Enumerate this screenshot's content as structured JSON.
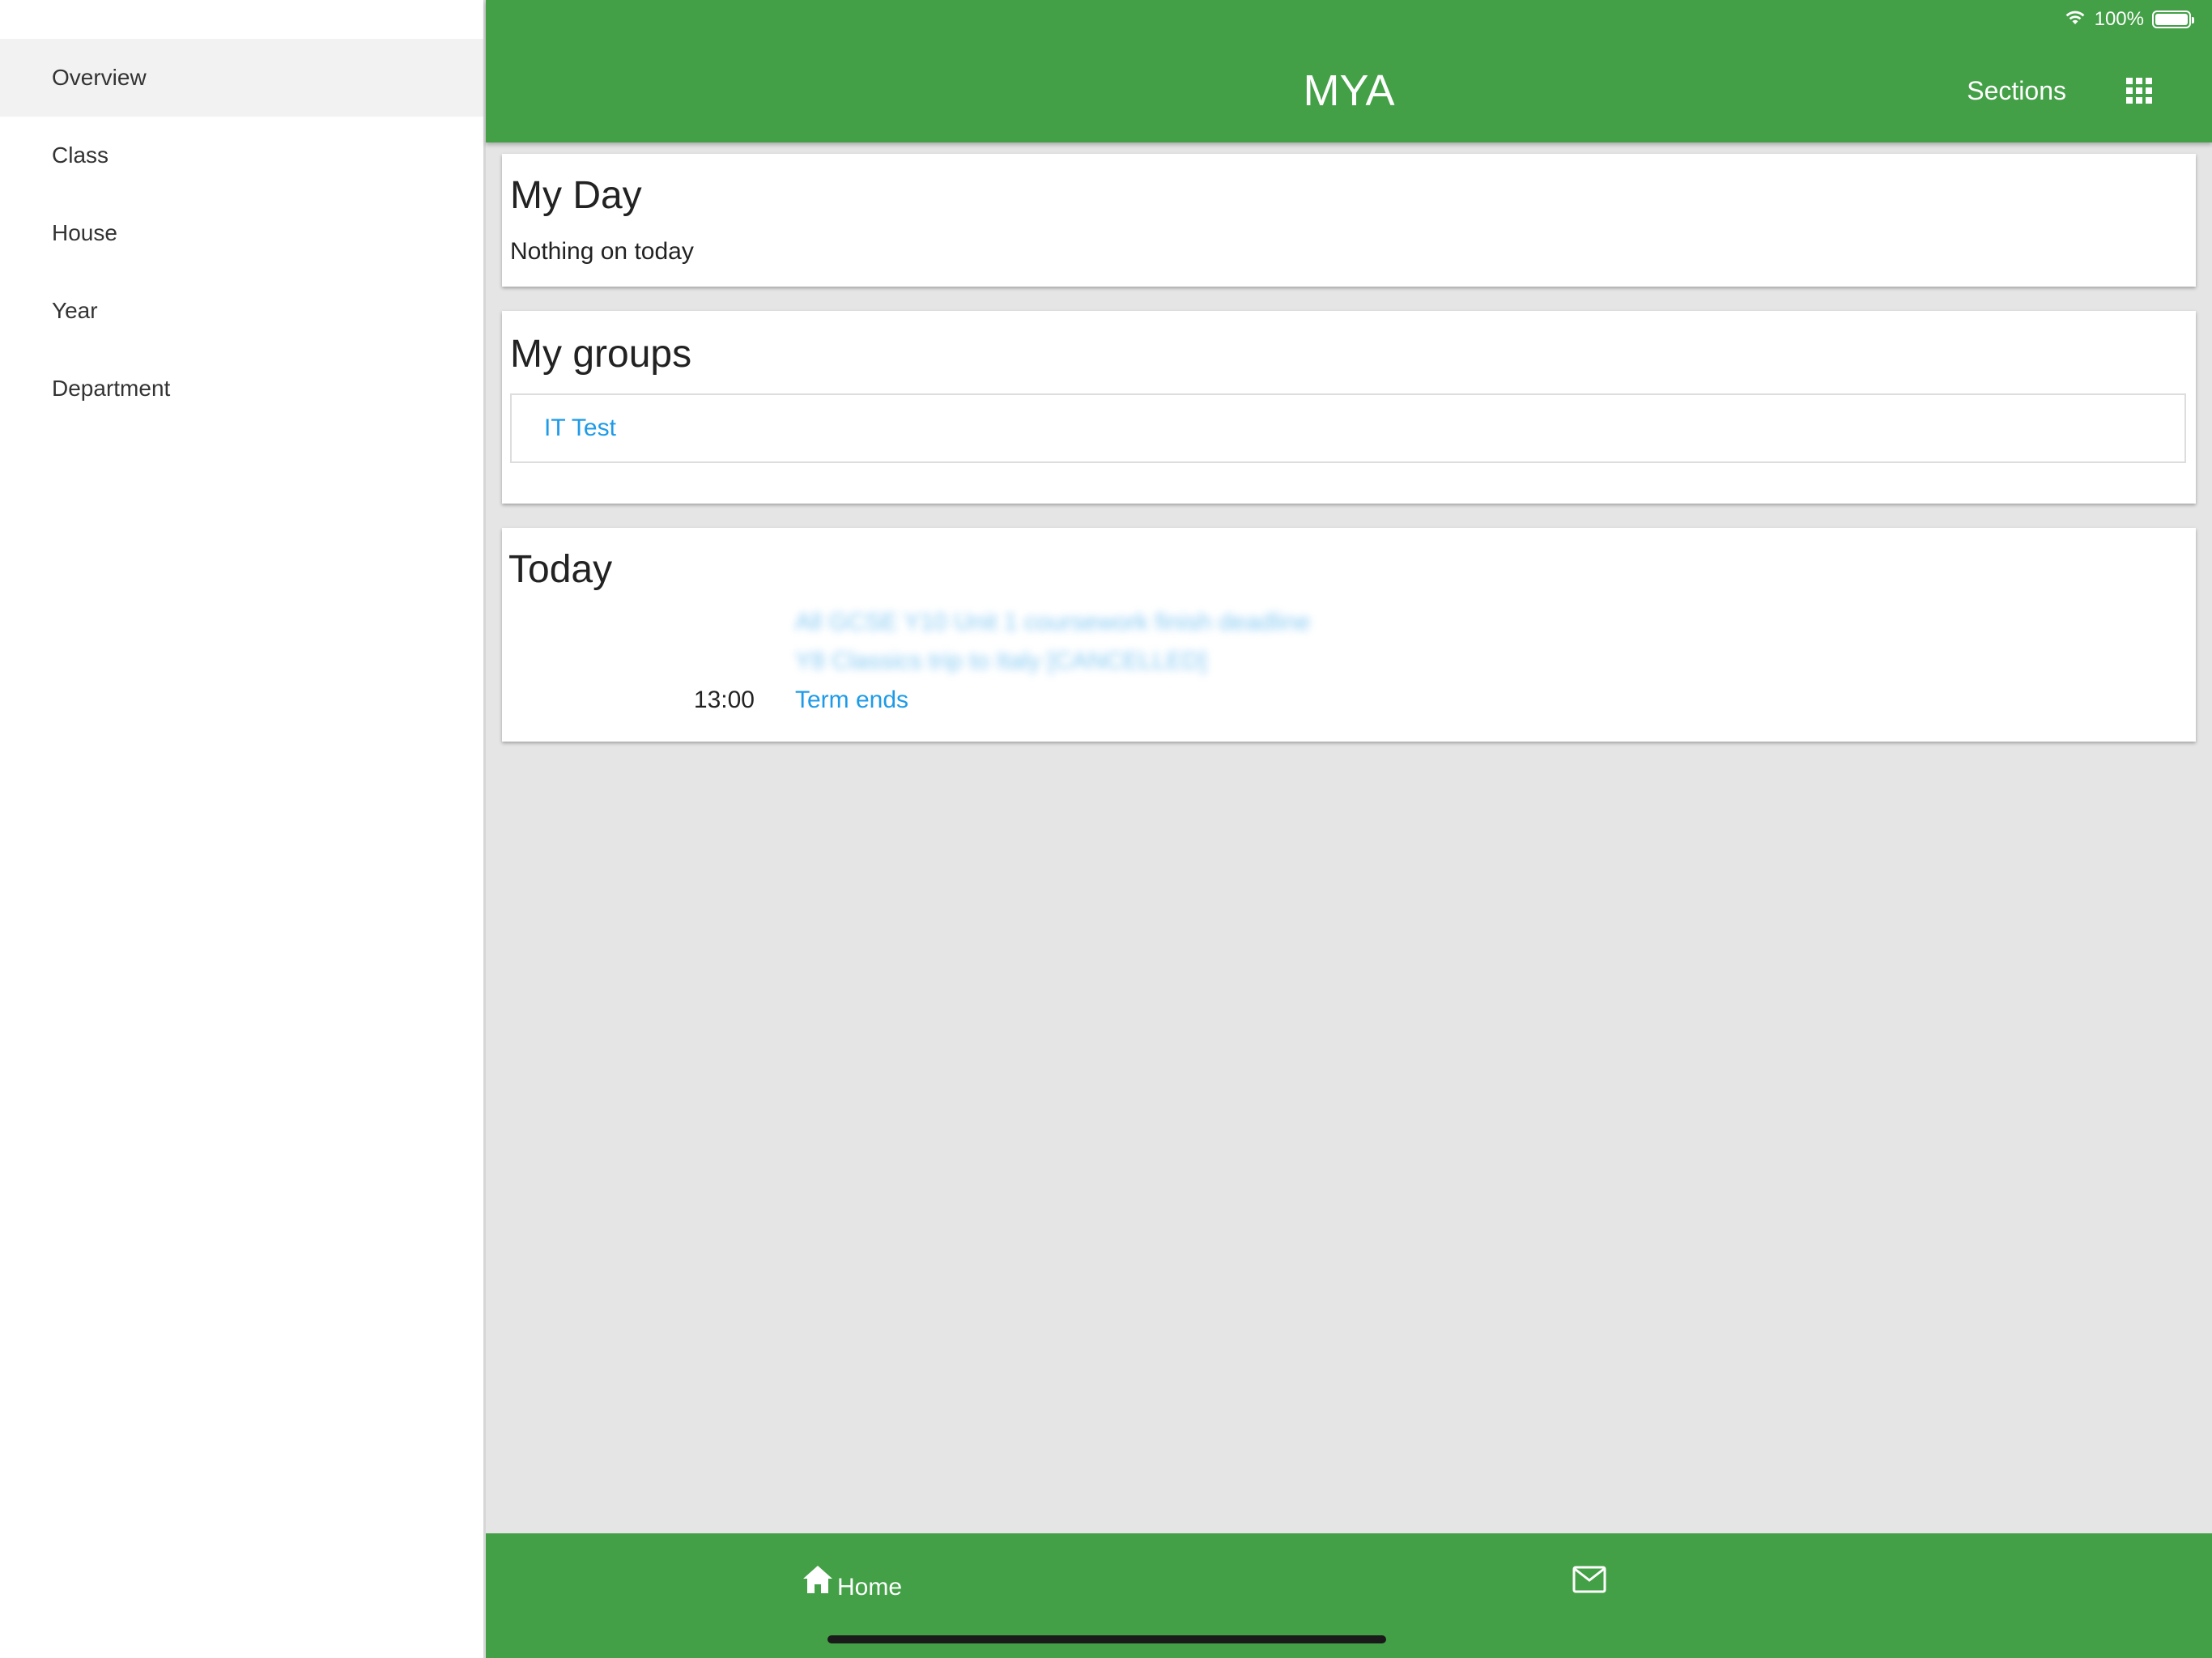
{
  "status_bar": {
    "battery_text": "100%",
    "icons": [
      "wifi-icon",
      "battery-icon"
    ]
  },
  "sidebar": {
    "items": [
      {
        "label": "Overview",
        "active": true
      },
      {
        "label": "Class",
        "active": false
      },
      {
        "label": "House",
        "active": false
      },
      {
        "label": "Year",
        "active": false
      },
      {
        "label": "Department",
        "active": false
      }
    ]
  },
  "header": {
    "title": "MYA",
    "sections_label": "Sections",
    "grid_icon": "grid-icon"
  },
  "my_day": {
    "title": "My Day",
    "empty_text": "Nothing on today"
  },
  "my_groups": {
    "title": "My groups",
    "groups": [
      {
        "label": "IT Test"
      }
    ]
  },
  "today": {
    "title": "Today",
    "events": [
      {
        "time": "",
        "title": "All GCSE Y10 Unit 1 coursework finish deadline",
        "obscured": true
      },
      {
        "time": "",
        "title": "Y8 Classics trip to Italy [CANCELLED]",
        "obscured": true
      },
      {
        "time": "13:00",
        "title": "Term ends",
        "obscured": false
      }
    ]
  },
  "tabbar": {
    "home_label": "Home",
    "home_icon": "home-icon",
    "mail_icon": "mail-icon"
  },
  "colors": {
    "brand_green": "#43a047",
    "link_blue": "#1e9be8",
    "background_gray": "#e5e5e5"
  }
}
